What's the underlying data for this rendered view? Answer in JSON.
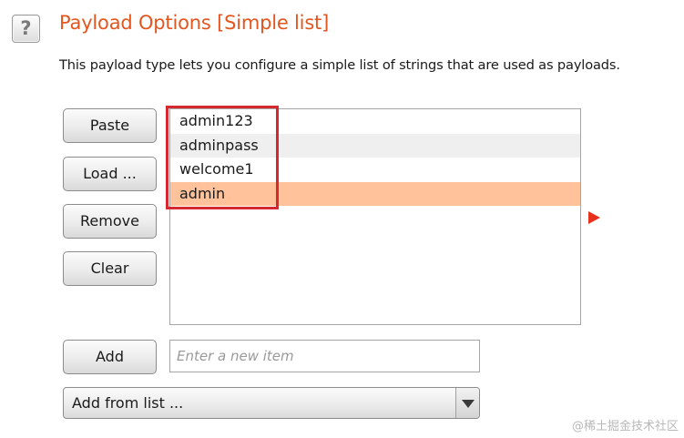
{
  "header": {
    "help_icon_glyph": "?",
    "title": "Payload Options [Simple list]",
    "title_color": "#e3561f"
  },
  "description": "This payload type lets you configure a simple list of strings that are used as payloads.",
  "buttons": {
    "paste": "Paste",
    "load": "Load ...",
    "remove": "Remove",
    "clear": "Clear",
    "add": "Add"
  },
  "payload_list": {
    "items": [
      {
        "label": "admin123",
        "selected": false
      },
      {
        "label": "adminpass",
        "selected": false
      },
      {
        "label": "welcome1",
        "selected": false
      },
      {
        "label": "admin",
        "selected": true
      }
    ],
    "selected_color": "#ffc29b",
    "highlight_border_color": "#d6282e"
  },
  "new_item": {
    "value": "",
    "placeholder": "Enter a new item"
  },
  "add_from_list": {
    "selected": "Add from list ..."
  },
  "watermark": "@稀土掘金技术社区"
}
